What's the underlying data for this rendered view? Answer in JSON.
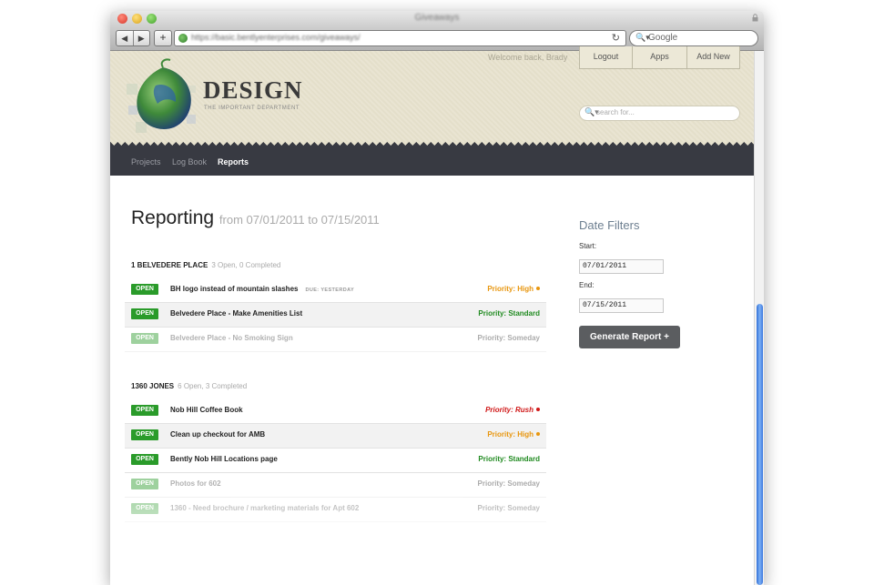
{
  "window": {
    "title": "Giveaways",
    "url": "https://basic.bentlyenterprises.com/giveaways/"
  },
  "browser": {
    "search_placeholder": "Google",
    "back": "◀",
    "forward": "▶",
    "add": "+",
    "reload": "↻",
    "search_glyph": "🔍▾"
  },
  "header": {
    "logo_title": "DESIGN",
    "logo_subtitle": "THE IMPORTANT DEPARTMENT",
    "welcome": "Welcome back, Brady",
    "buttons": [
      "Logout",
      "Apps",
      "Add New"
    ],
    "search_placeholder": "search for..."
  },
  "nav": {
    "items": [
      "Projects",
      "Log Book",
      "Reports"
    ],
    "active": "Reports"
  },
  "report": {
    "title": "Reporting",
    "range": "from 07/01/2011 to 07/15/2011"
  },
  "groups": [
    {
      "name": "1 BELVEDERE PLACE",
      "summary": "3 Open, 0 Completed",
      "items": [
        {
          "status": "OPEN",
          "title": "BH logo instead of mountain slashes",
          "due": "DUE: YESTERDAY",
          "priority": "Priority: High"
        },
        {
          "status": "OPEN",
          "title": "Belvedere Place - Make Amenities List",
          "due": "",
          "priority": "Priority: Standard"
        },
        {
          "status": "OPEN",
          "title": "Belvedere Place - No Smoking Sign",
          "due": "",
          "priority": "Priority: Someday"
        }
      ]
    },
    {
      "name": "1360 JONES",
      "summary": "6 Open, 3 Completed",
      "items": [
        {
          "status": "OPEN",
          "title": "Nob Hill Coffee Book",
          "due": "",
          "priority": "Priority: Rush"
        },
        {
          "status": "OPEN",
          "title": "Clean up checkout for AMB",
          "due": "",
          "priority": "Priority: High"
        },
        {
          "status": "OPEN",
          "title": "Bently Nob Hill Locations page",
          "due": "",
          "priority": "Priority: Standard"
        },
        {
          "status": "OPEN",
          "title": "Photos for 602",
          "due": "",
          "priority": "Priority: Someday"
        },
        {
          "status": "OPEN",
          "title": "1360 - Need brochure / marketing materials for Apt 602",
          "due": "",
          "priority": "Priority: Someday"
        }
      ]
    }
  ],
  "filters": {
    "title": "Date Filters",
    "start_label": "Start:",
    "start_value": "07/01/2011",
    "end_label": "End:",
    "end_value": "07/15/2011",
    "generate": "Generate Report +"
  },
  "colors": {
    "open_badge": "#2a9b2a",
    "high": "#e8960e",
    "standard": "#1f8a1f",
    "rush": "#d01818",
    "someday": "#9a9a9a",
    "nav_bg": "#383a42"
  }
}
